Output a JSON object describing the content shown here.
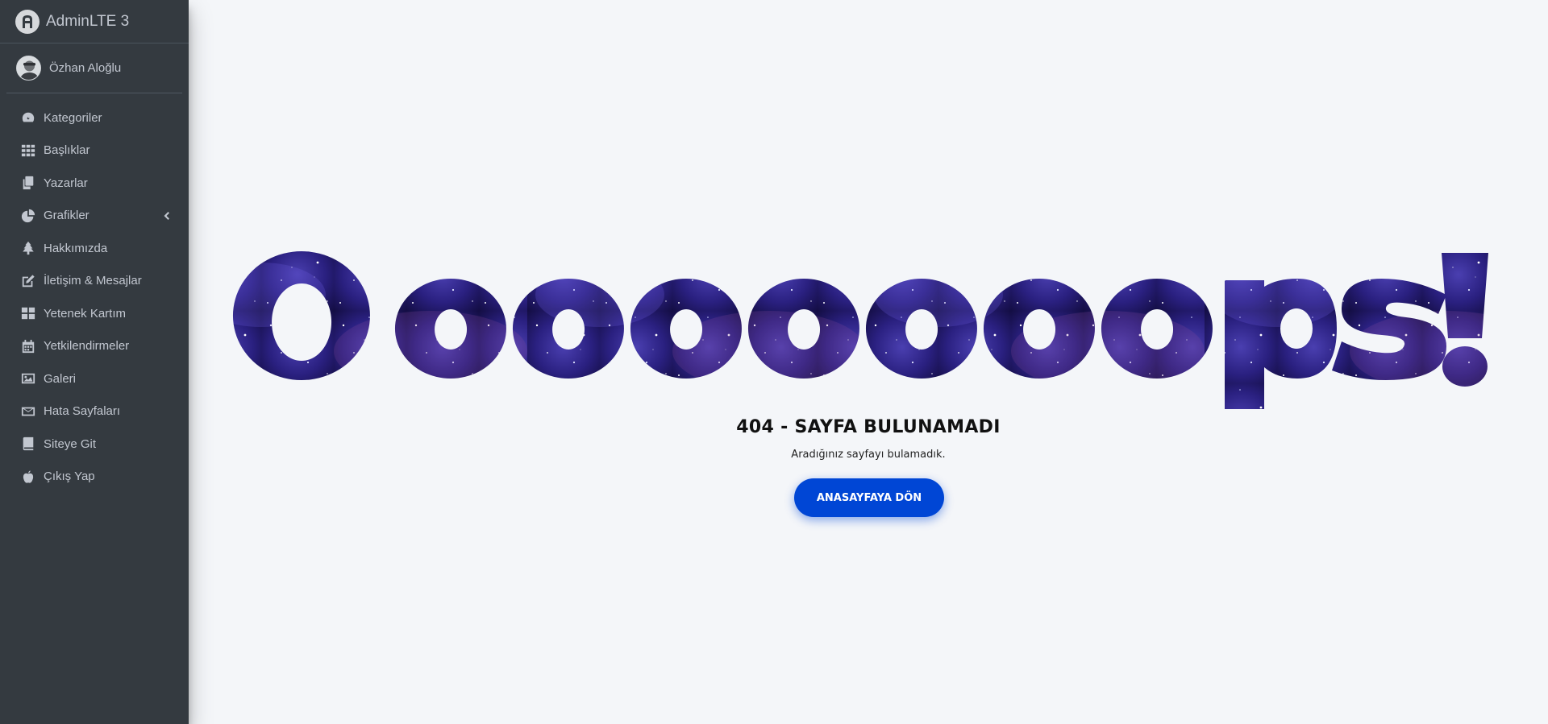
{
  "brand": {
    "name": "AdminLTE 3"
  },
  "user": {
    "name": "Özhan Aloğlu"
  },
  "sidebar": {
    "items": [
      {
        "label": "Kategoriler",
        "icon": "tachometer-icon"
      },
      {
        "label": "Başlıklar",
        "icon": "th-icon"
      },
      {
        "label": "Yazarlar",
        "icon": "copy-icon"
      },
      {
        "label": "Grafikler",
        "icon": "chart-pie-icon",
        "has_submenu": true
      },
      {
        "label": "Hakkımızda",
        "icon": "tree-icon"
      },
      {
        "label": "İletişim & Mesajlar",
        "icon": "edit-icon"
      },
      {
        "label": "Yetenek Kartım",
        "icon": "th-large-icon"
      },
      {
        "label": "Yetkilendirmeler",
        "icon": "calendar-icon"
      },
      {
        "label": "Galeri",
        "icon": "image-icon"
      },
      {
        "label": "Hata Sayfaları",
        "icon": "envelope-icon"
      },
      {
        "label": "Siteye Git",
        "icon": "book-icon"
      },
      {
        "label": "Çıkış Yap",
        "icon": "apple-icon"
      }
    ]
  },
  "error_page": {
    "big_text": "Oooooooops!",
    "heading": "404 - SAYFA BULUNAMADI",
    "message": "Aradığınız sayfayı bulamadık.",
    "button_label": "ANASAYFAYA DÖN"
  },
  "colors": {
    "sidebar_bg": "#343a40",
    "sidebar_text": "#c2c7d0",
    "page_bg": "#f4f6f9",
    "button_bg": "#0046d5",
    "galaxy_dark": "#1a1250",
    "galaxy_light": "#5a4cc8"
  }
}
